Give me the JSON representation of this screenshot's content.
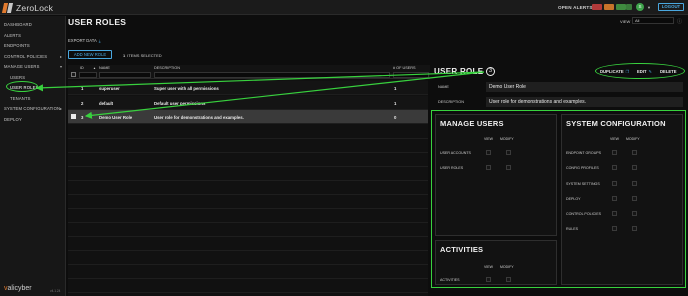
{
  "app": {
    "logo_text": "ZeroLock",
    "version": "v4.1.24"
  },
  "topbar": {
    "open_alerts_label": "OPEN ALERTS",
    "alert_colors": [
      "#b23a3a",
      "#c8742a",
      "#3f8a3f",
      "#3a7a3a"
    ],
    "avatar_initial": "S",
    "logout_label": "LOGOUT"
  },
  "sidebar": {
    "items": [
      {
        "label": "DASHBOARD"
      },
      {
        "label": "ALERTS"
      },
      {
        "label": "ENDPOINTS"
      },
      {
        "label": "CONTROL POLICIES"
      },
      {
        "label": "MANAGE USERS"
      },
      {
        "label": "USERS"
      },
      {
        "label": "USER ROLES"
      },
      {
        "label": "TENANTS"
      },
      {
        "label": "SYSTEM CONFIGURATION"
      },
      {
        "label": "DEPLOY"
      }
    ],
    "brand_prefix": "v",
    "brand_suffix": "alicyber"
  },
  "main": {
    "title": "USER ROLES",
    "view_label": "VIEW",
    "view_value": "All",
    "export_label": "EXPORT DATA",
    "add_role_label": "ADD NEW ROLE",
    "items_selected_count": "1",
    "items_selected_label": "ITEMS SELECTED",
    "table": {
      "columns": {
        "id": "ID",
        "sort": "▲",
        "name": "NAME",
        "description": "DESCRIPTION",
        "users": "# OF USERS"
      },
      "rows": [
        {
          "id": "1",
          "name": "superuser",
          "description": "Super user with all permissions",
          "users": "1"
        },
        {
          "id": "2",
          "name": "default",
          "description": "Default user permissions",
          "users": "1"
        },
        {
          "id": "3",
          "name": "Demo User Role",
          "description": "User role for demonstrations and examples.",
          "users": "0"
        }
      ]
    }
  },
  "detail": {
    "title": "USER ROLE",
    "step": "3",
    "actions": {
      "duplicate": "DUPLICATE",
      "edit": "EDIT",
      "delete": "DELETE"
    },
    "name_label": "NAME",
    "name_value": "Demo User Role",
    "description_label": "DESCRIPTION",
    "description_value": "User role for demonstrations and examples.",
    "view_col": "VIEW",
    "modify_col": "MODIFY",
    "manage_users": {
      "title": "MANAGE USERS",
      "items": [
        "USER ACCOUNTS",
        "USER ROLES"
      ]
    },
    "system_configuration": {
      "title": "SYSTEM CONFIGURATION",
      "items": [
        "ENDPOINT GROUPS",
        "CONFIG PROFILES",
        "SYSTEM SETTINGS",
        "DEPLOY",
        "CONTROL POLICIES",
        "RULES"
      ]
    },
    "activities": {
      "title": "ACTIVITIES",
      "items": [
        "ACTIVITIES"
      ]
    }
  },
  "colors": {
    "accent": "#4aa8e0",
    "annotation": "#38d13e",
    "brand_orange": "#e07a2e"
  }
}
